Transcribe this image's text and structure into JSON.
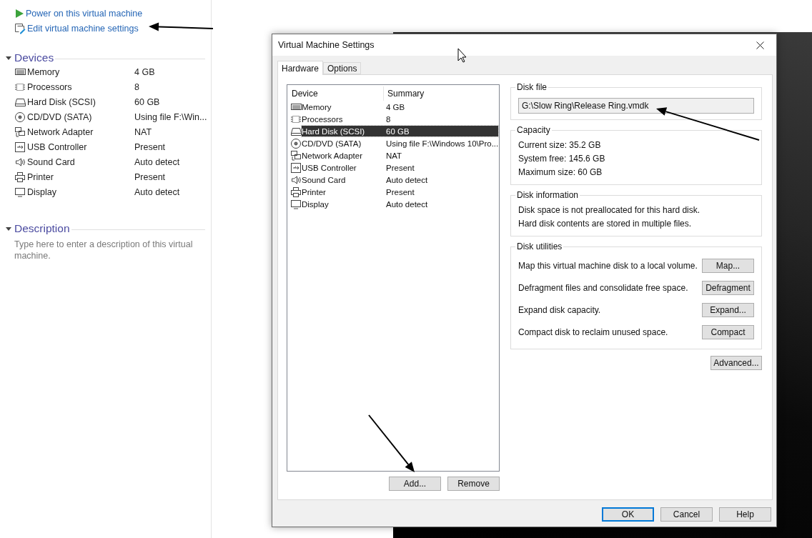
{
  "sidebar": {
    "actions": [
      {
        "label": "Power on this virtual machine",
        "kind": "power"
      },
      {
        "label": "Edit virtual machine settings",
        "kind": "edit"
      }
    ],
    "devices": {
      "title": "Devices",
      "expanded": true,
      "items": [
        {
          "name": "Memory",
          "value": "4 GB",
          "kind": "memory"
        },
        {
          "name": "Processors",
          "value": "8",
          "kind": "processor"
        },
        {
          "name": "Hard Disk (SCSI)",
          "value": "60 GB",
          "kind": "disk"
        },
        {
          "name": "CD/DVD (SATA)",
          "value": "Using file F:\\Win...",
          "kind": "cd"
        },
        {
          "name": "Network Adapter",
          "value": "NAT",
          "kind": "network"
        },
        {
          "name": "USB Controller",
          "value": "Present",
          "kind": "usb"
        },
        {
          "name": "Sound Card",
          "value": "Auto detect",
          "kind": "sound"
        },
        {
          "name": "Printer",
          "value": "Present",
          "kind": "printer"
        },
        {
          "name": "Display",
          "value": "Auto detect",
          "kind": "display"
        }
      ]
    },
    "description": {
      "title": "Description",
      "expanded": true,
      "placeholder": "Type here to enter a description of this virtual machine."
    }
  },
  "dialog": {
    "title": "Virtual Machine Settings",
    "tabs": [
      {
        "label": "Hardware",
        "selected": true
      },
      {
        "label": "Options",
        "selected": false
      }
    ],
    "device_list": {
      "columns": [
        "Device",
        "Summary"
      ],
      "rows": [
        {
          "name": "Memory",
          "summary": "4 GB",
          "kind": "memory",
          "selected": false
        },
        {
          "name": "Processors",
          "summary": "8",
          "kind": "processor",
          "selected": false
        },
        {
          "name": "Hard Disk (SCSI)",
          "summary": "60 GB",
          "kind": "disk",
          "selected": true
        },
        {
          "name": "CD/DVD (SATA)",
          "summary": "Using file F:\\Windows 10\\Pro...",
          "kind": "cd",
          "selected": false
        },
        {
          "name": "Network Adapter",
          "summary": "NAT",
          "kind": "network",
          "selected": false
        },
        {
          "name": "USB Controller",
          "summary": "Present",
          "kind": "usb",
          "selected": false
        },
        {
          "name": "Sound Card",
          "summary": "Auto detect",
          "kind": "sound",
          "selected": false
        },
        {
          "name": "Printer",
          "summary": "Present",
          "kind": "printer",
          "selected": false
        },
        {
          "name": "Display",
          "summary": "Auto detect",
          "kind": "display",
          "selected": false
        }
      ]
    },
    "list_buttons": [
      "Add...",
      "Remove"
    ],
    "disk_file": {
      "title": "Disk file",
      "value": "G:\\Slow Ring\\Release Ring.vmdk"
    },
    "capacity": {
      "title": "Capacity",
      "lines": [
        "Current size:  35.2 GB",
        "System free:  145.6 GB",
        "Maximum size:  60 GB"
      ]
    },
    "disk_information": {
      "title": "Disk information",
      "lines": [
        "Disk space is not preallocated for this hard disk.",
        "Hard disk contents are stored in multiple files."
      ]
    },
    "disk_utilities": {
      "title": "Disk utilities",
      "rows": [
        {
          "text": "Map this virtual machine disk to a local volume.",
          "button": "Map..."
        },
        {
          "text": "Defragment files and consolidate free space.",
          "button": "Defragment"
        },
        {
          "text": "Expand disk capacity.",
          "button": "Expand..."
        },
        {
          "text": "Compact disk to reclaim unused space.",
          "button": "Compact"
        }
      ]
    },
    "advanced_button": "Advanced...",
    "footer_buttons": [
      {
        "label": "OK",
        "default": true
      },
      {
        "label": "Cancel",
        "default": false
      },
      {
        "label": "Help",
        "default": false
      }
    ]
  }
}
